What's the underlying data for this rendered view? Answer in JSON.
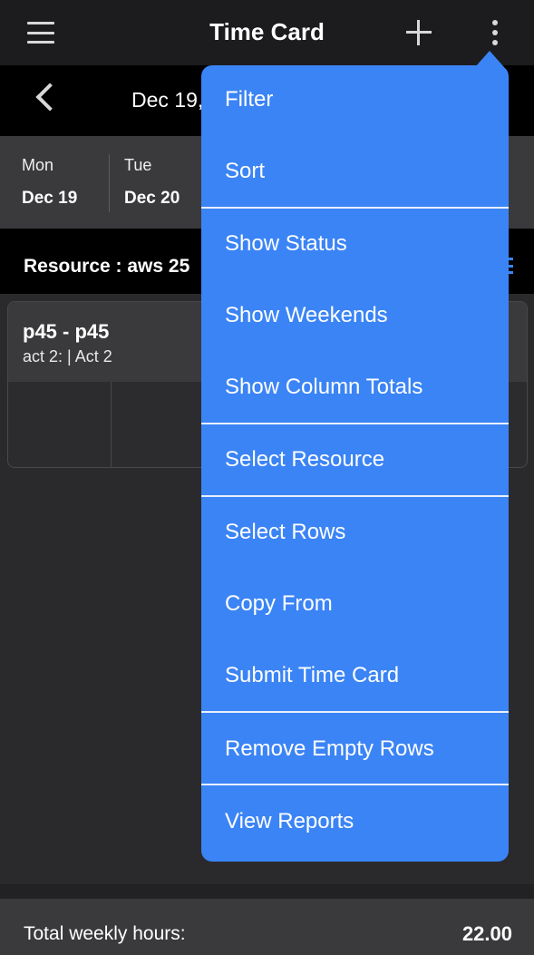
{
  "navbar": {
    "title": "Time Card",
    "menu_icon": "hamburger-icon",
    "add_icon": "plus-icon",
    "more_icon": "vertical-dots-icon"
  },
  "datebar": {
    "back_icon": "chevron-left-icon",
    "date_range": "Dec 19,"
  },
  "week": {
    "days": [
      {
        "name": "Mon",
        "date": "Dec 19"
      },
      {
        "name": "Tue",
        "date": "Dec 20"
      }
    ]
  },
  "resource": {
    "label": "Resource :  aws 25",
    "list_icon": "list-icon"
  },
  "row": {
    "title": "p45 - p45",
    "subtitle": "act 2: | Act 2"
  },
  "footer": {
    "label": "Total weekly hours:",
    "value": "22.00"
  },
  "menu": {
    "items": [
      "Filter",
      "Sort",
      "Show Status",
      "Show Weekends",
      "Show Column Totals",
      "Select Resource",
      "Select Rows",
      "Copy From",
      "Submit Time Card",
      "Remove Empty Rows",
      "View Reports"
    ]
  },
  "colors": {
    "menu_accent": "#3b84f5",
    "navbar_bg": "#1c1c1e",
    "subbar_bg": "#000000",
    "panel_bg": "#3a3a3c"
  }
}
